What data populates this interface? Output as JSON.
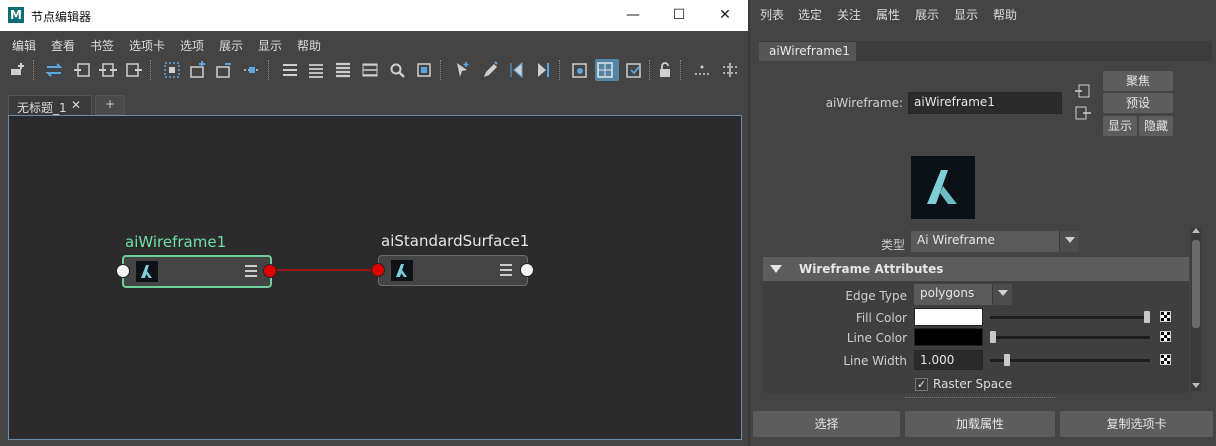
{
  "node_editor": {
    "window": {
      "title": "节点编辑器",
      "logo_letter": "M",
      "minimize_symbol": "—",
      "maximize_symbol": "☐",
      "close_symbol": "✕"
    },
    "menu": [
      "编辑",
      "查看",
      "书签",
      "选项卡",
      "选项",
      "展示",
      "显示",
      "帮助"
    ],
    "toolbar_icons": [
      "add-node-icon",
      "swap-arrows-icon",
      "input-connections-icon",
      "input-output-connections-icon",
      "output-connections-icon",
      "clear-graph-icon",
      "add-selected-icon",
      "remove-selected-icon",
      "graph-up-down-icon",
      "simple-mode-icon",
      "connected-mode-icon",
      "full-mode-icon",
      "custom-mode-icon",
      "search-icon",
      "frame-all-icon",
      "pin-icon",
      "edit-icon",
      "back-icon",
      "forward-icon",
      "shader-swatch-icon",
      "grid-snap-icon",
      "grid-toggle-icon",
      "lock-icon",
      "attribute-filter-icon",
      "node-layout-icon"
    ],
    "active_toolbar_icon": "grid-snap-icon",
    "tabs": [
      {
        "label": "无标题_1",
        "close_symbol": "✕"
      }
    ],
    "new_tab_symbol": "+",
    "nodes": [
      {
        "name": "aiWireframe1",
        "selected": true,
        "name_color": "#6fe0a8"
      },
      {
        "name": "aiStandardSurface1",
        "selected": false,
        "name_color": "#e6e6e6"
      }
    ],
    "connection_color": "#c01010"
  },
  "attribute_editor": {
    "menu": [
      "列表",
      "选定",
      "关注",
      "属性",
      "展示",
      "显示",
      "帮助"
    ],
    "tab_label": "aiWireframe1",
    "node_label": "aiWireframe:",
    "node_value": "aiWireframe1",
    "buttons": {
      "focus": "聚焦",
      "presets": "预设",
      "show": "显示",
      "hide": "隐藏"
    },
    "type_label": "类型",
    "type_value": "Ai Wireframe",
    "section_title": "Wireframe Attributes",
    "edge_type": {
      "label": "Edge Type",
      "value": "polygons"
    },
    "fill_color": {
      "label": "Fill Color",
      "color": "#ffffff",
      "slider_value": 1.0
    },
    "line_color": {
      "label": "Line Color",
      "color": "#000000",
      "slider_value": 0.0
    },
    "line_width": {
      "label": "Line Width",
      "value": "1.000"
    },
    "raster_space": {
      "label": "Raster Space",
      "checked": true
    },
    "bottom_buttons": {
      "select": "选择",
      "load_attributes": "加载属性",
      "copy_tab": "复制选项卡"
    }
  }
}
